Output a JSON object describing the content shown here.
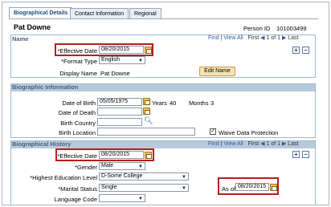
{
  "tabs": [
    "Biographical Details",
    "Contact Information",
    "Regional"
  ],
  "header": {
    "name": "Pat Downe",
    "person_id_label": "Person ID",
    "person_id": "101003499"
  },
  "name_section": {
    "title": "Name",
    "nav": {
      "find": "Find",
      "view_all": "View All",
      "first": "First",
      "count": "1 of 1",
      "last": "Last"
    },
    "effective_date_label": "*Effective Date",
    "effective_date": "08/20/2015",
    "format_type_label": "*Format Type",
    "format_type": "English",
    "display_name_label": "Display Name",
    "display_name": "Pat Downe",
    "edit_name_button": "Edit Name"
  },
  "bio_info": {
    "title": "Biographic Information",
    "dob_label": "Date of Birth",
    "dob": "05/05/1975",
    "years_label": "Years",
    "years": "40",
    "months_label": "Months",
    "months": "3",
    "dod_label": "Date of Death",
    "dod": "",
    "birth_country_label": "Birth Country",
    "birth_country": "",
    "birth_location_label": "Birth Location",
    "birth_location": "",
    "waive_label": "Waive Data Protection",
    "waive_checked": "✓"
  },
  "bio_history": {
    "title": "Biographical History",
    "nav": {
      "find": "Find",
      "view_all": "View All",
      "first": "First",
      "count": "1 of 1",
      "last": "Last"
    },
    "effective_date_label": "*Effective Date",
    "effective_date": "08/20/2015",
    "gender_label": "*Gender",
    "gender": "Male",
    "education_label": "*Highest Education Level",
    "education": "D-Some College",
    "marital_label": "*Marital Status",
    "marital": "Single",
    "language_label": "Language Code",
    "language": "",
    "as_of_label": "As of",
    "as_of": "08/20/2015"
  },
  "colors": {
    "section_header": "#b7c9dd",
    "highlight": "#b81d1d",
    "link": "#2c5fa3"
  }
}
